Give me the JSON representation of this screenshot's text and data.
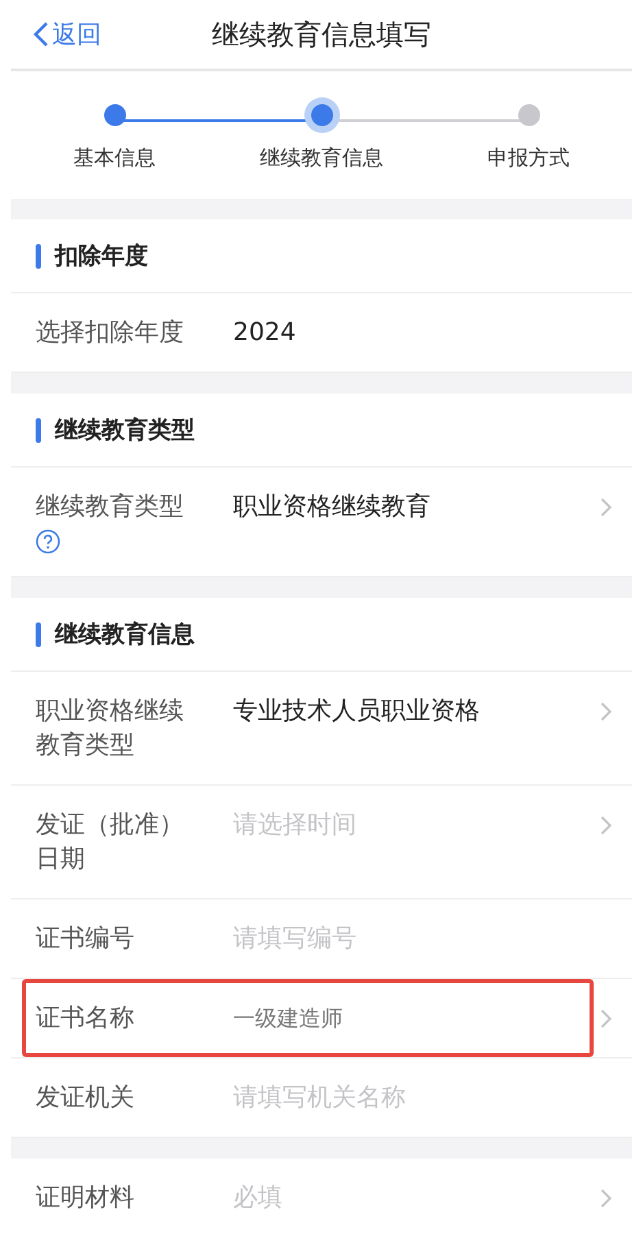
{
  "header": {
    "back": "返回",
    "title": "继续教育信息填写"
  },
  "steps": [
    {
      "label": "基本信息",
      "done": true,
      "selected": false
    },
    {
      "label": "继续教育信息",
      "done": false,
      "selected": true
    },
    {
      "label": "申报方式",
      "done": false,
      "selected": false
    }
  ],
  "sections": [
    {
      "title": "扣除年度",
      "rows": [
        {
          "label": "选择扣除年度",
          "value": "2024",
          "arrow": false
        }
      ]
    },
    {
      "title": "继续教育类型",
      "rows": [
        {
          "label": "继续教育类型",
          "value": "职业资格继续教育",
          "arrow": true,
          "help": true
        }
      ]
    },
    {
      "title": "继续教育信息",
      "rows": [
        {
          "label": "职业资格继续教育类型",
          "value": "专业技术人员职业资格",
          "arrow": true
        },
        {
          "label": "发证（批准）日期",
          "placeholder": "请选择时间",
          "arrow": true
        },
        {
          "label": "证书编号",
          "placeholder": "请填写编号",
          "arrow": false
        },
        {
          "label": "证书名称",
          "value": "一级建造师",
          "arrow": true,
          "highlighted": true
        },
        {
          "label": "发证机关",
          "placeholder": "请填写机关名称",
          "arrow": false
        }
      ]
    },
    {
      "rows": [
        {
          "label": "证明材料",
          "placeholder": "必填",
          "arrow": true
        }
      ]
    }
  ]
}
